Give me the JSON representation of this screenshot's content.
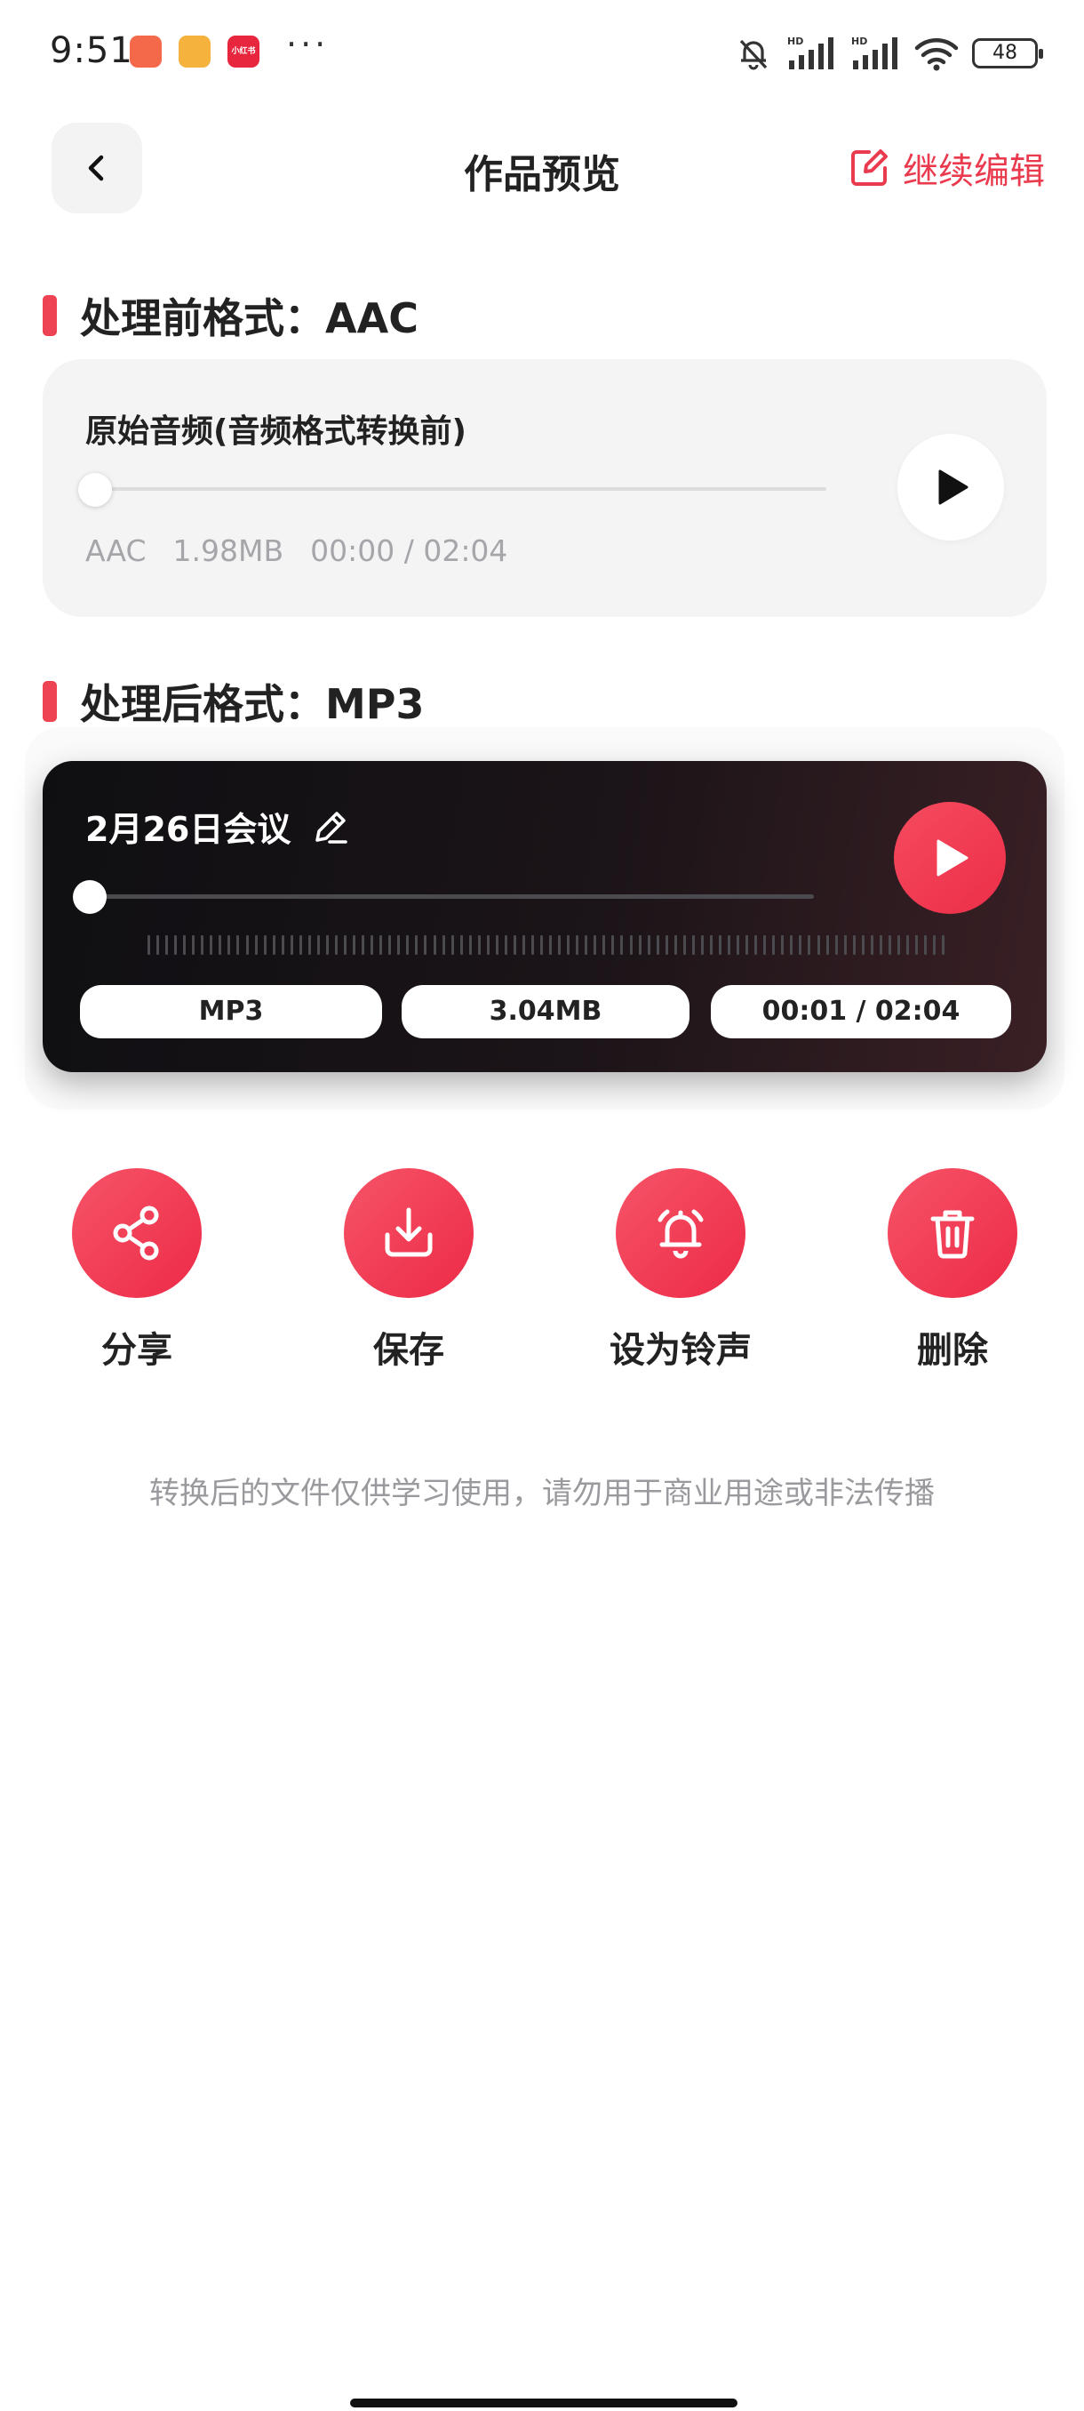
{
  "status_bar": {
    "time": "9:51",
    "app3_label": "小红书",
    "more": "···",
    "battery": "48"
  },
  "header": {
    "title": "作品预览",
    "edit_label": "继续编辑"
  },
  "original": {
    "section_label": "处理前格式：AAC",
    "card_title": "原始音频(音频格式转换前)",
    "format": "AAC",
    "size": "1.98MB",
    "time": "00:00 / 02:04",
    "progress": 0
  },
  "result": {
    "section_label": "处理后格式：MP3",
    "name": "2月26日会议",
    "format": "MP3",
    "size": "3.04MB",
    "time": "00:01 / 02:04",
    "progress": 0.01
  },
  "actions": [
    {
      "label": "分享",
      "icon": "share-icon"
    },
    {
      "label": "保存",
      "icon": "download-icon"
    },
    {
      "label": "设为铃声",
      "icon": "bell-icon"
    },
    {
      "label": "删除",
      "icon": "trash-icon"
    }
  ],
  "disclaimer": "转换后的文件仅供学习使用，请勿用于商业用途或非法传播",
  "colors": {
    "accent": "#ee3a4f",
    "card_dark": "#17131a",
    "muted_text": "#a6a6aa"
  }
}
